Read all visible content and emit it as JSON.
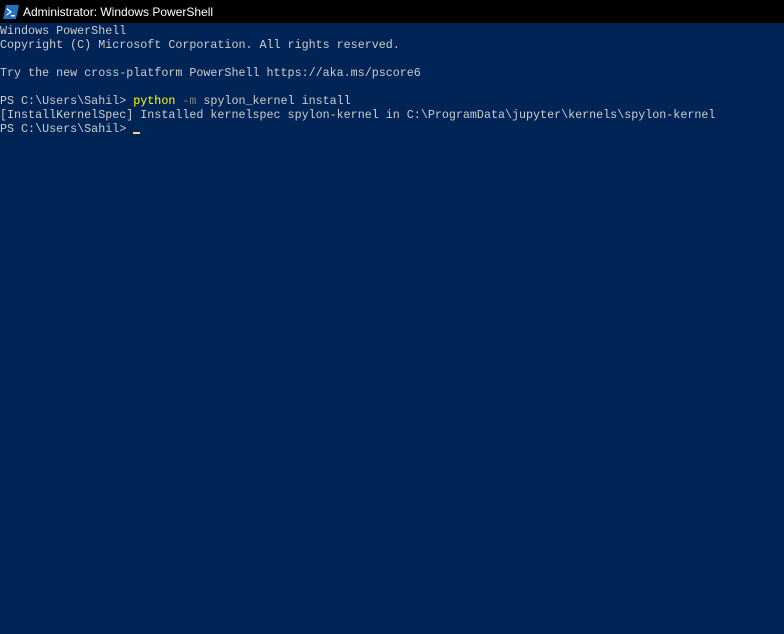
{
  "window": {
    "title": "Administrator: Windows PowerShell",
    "icon": "powershell-icon"
  },
  "colors": {
    "background": "#012456",
    "foreground": "#cccccc",
    "command": "#ffff00",
    "parameter": "#808080",
    "cursor": "#ffd27f"
  },
  "console": {
    "banner_line1": "Windows PowerShell",
    "banner_line2": "Copyright (C) Microsoft Corporation. All rights reserved.",
    "tip_line": "Try the new cross-platform PowerShell https://aka.ms/pscore6",
    "prompt1": "PS C:\\Users\\Sahil> ",
    "command1": {
      "exe": "python",
      "param": "-m",
      "args": "spylon_kernel install"
    },
    "output1": "[InstallKernelSpec] Installed kernelspec spylon-kernel in C:\\ProgramData\\jupyter\\kernels\\spylon-kernel",
    "prompt2": "PS C:\\Users\\Sahil> "
  }
}
